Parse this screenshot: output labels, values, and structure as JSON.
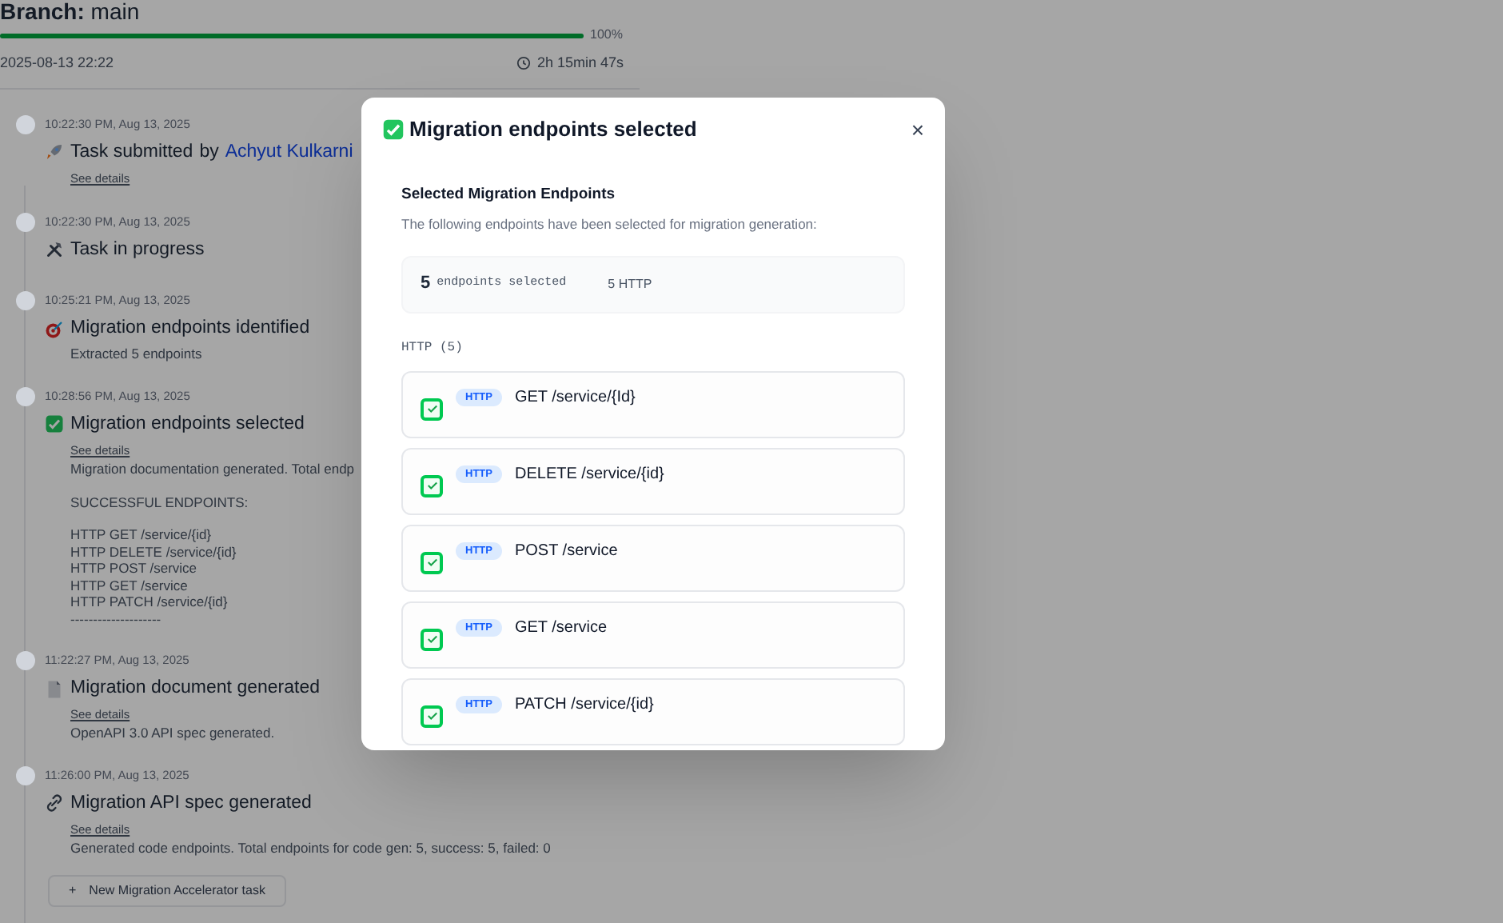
{
  "header": {
    "branch_label": "Branch:",
    "branch": "main",
    "progress": {
      "level": 1.0,
      "reading": "100%"
    },
    "date": "2025-08-13 22:22",
    "duration": "2h 15min 47s"
  },
  "timeline": [
    {
      "time": "10:22:30 PM, Aug 13, 2025",
      "kind": "rocket",
      "title": "Task submitted",
      "by": "by",
      "author": "Achyut Kulkarni",
      "details_link": "See details"
    },
    {
      "time": "10:22:30 PM, Aug 13, 2025",
      "kind": "tools",
      "title": "Task in progress"
    },
    {
      "time": "10:25:21 PM, Aug 13, 2025",
      "kind": "target",
      "title": "Migration endpoints identified",
      "paragraphs": [
        [
          "Extracted 5 endpoints"
        ]
      ]
    },
    {
      "time": "10:28:56 PM, Aug 13, 2025",
      "kind": "check",
      "title": "Migration endpoints selected",
      "details_link": "See details",
      "paragraphs": [
        [
          "Migration documentation generated. Total endp"
        ],
        [
          "SUCCESSFUL ENDPOINTS:"
        ],
        [
          "HTTP GET /service/{id}",
          "HTTP DELETE /service/{id}",
          "HTTP POST /service",
          "HTTP GET /service",
          "HTTP PATCH /service/{id}",
          "--------------------"
        ]
      ]
    },
    {
      "time": "11:22:27 PM, Aug 13, 2025",
      "kind": "document",
      "title": "Migration document generated",
      "details_link": "See details",
      "paragraphs": [
        [
          "OpenAPI 3.0 API spec generated."
        ]
      ]
    },
    {
      "time": "11:26:00 PM, Aug 13, 2025",
      "kind": "link",
      "title": "Migration API spec generated",
      "details_link": "See details",
      "paragraphs": [
        [
          "Generated code endpoints. Total endpoints for code gen: 5, success: 5, failed: 0"
        ]
      ]
    }
  ],
  "new_task_button": {
    "plus": "+",
    "label": "New Migration Accelerator task"
  },
  "modal": {
    "title": "Migration endpoints selected",
    "close": "×",
    "section_title": "Selected Migration Endpoints",
    "description": "The following endpoints have been selected for migration generation:",
    "summary": {
      "count": "5",
      "count_label": "endpoints selected",
      "http_count": "5 HTTP"
    },
    "group_label": "HTTP (5)",
    "endpoints": [
      {
        "checked": true,
        "badge": "HTTP",
        "path": "GET /service/{Id}"
      },
      {
        "checked": true,
        "badge": "HTTP",
        "path": "DELETE /service/{id}"
      },
      {
        "checked": true,
        "badge": "HTTP",
        "path": "POST /service"
      },
      {
        "checked": true,
        "badge": "HTTP",
        "path": "GET /service"
      },
      {
        "checked": true,
        "badge": "HTTP",
        "path": "PATCH /service/{id}"
      }
    ]
  }
}
